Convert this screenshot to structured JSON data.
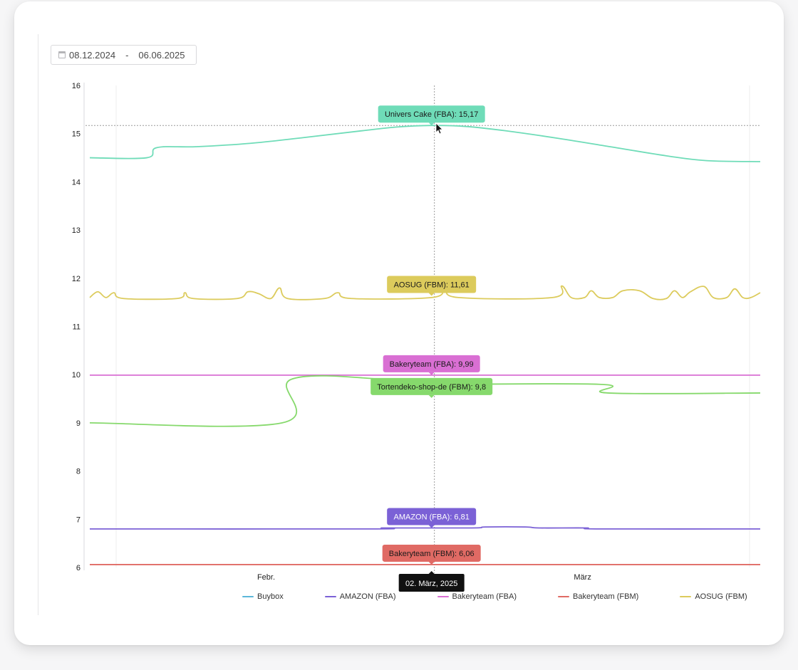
{
  "date_range": {
    "from": "08.12.2024",
    "separator": "-",
    "to": "06.06.2025"
  },
  "colors": {
    "buybox": "#5bb7d9",
    "amazon_fba": "#7b61d6",
    "bakeryteam_fba": "#d96fd3",
    "bakeryteam_fbm": "#e06a64",
    "aosug_fbm": "#dccb5c",
    "univers_cake_fba": "#6fdcb8",
    "tortendeko_fbm": "#86d96c"
  },
  "chart_data": {
    "type": "line",
    "ylim": [
      6,
      16
    ],
    "y_ticks": [
      "6",
      "7",
      "8",
      "9",
      "10",
      "11",
      "12",
      "13",
      "14",
      "15",
      "16"
    ],
    "x_ticks": [
      "Febr.",
      "März"
    ],
    "xlim": [
      0,
      100
    ],
    "hover": {
      "x": 51.4,
      "date_label": "02. März, 2025",
      "value": 15.17
    },
    "series": [
      {
        "name": "Univers Cake (FBA)",
        "color": "#6fdcb8",
        "tooltip": "Univers Cake (FBA): 15,17",
        "points": [
          [
            0,
            14.5
          ],
          [
            8.5,
            14.5
          ],
          [
            10,
            14.71
          ],
          [
            16,
            14.73
          ],
          [
            24,
            14.8
          ],
          [
            32,
            14.92
          ],
          [
            40,
            15.05
          ],
          [
            46,
            15.14
          ],
          [
            51,
            15.17
          ],
          [
            56,
            15.15
          ],
          [
            62,
            15.06
          ],
          [
            70,
            14.9
          ],
          [
            78,
            14.72
          ],
          [
            86,
            14.54
          ],
          [
            92,
            14.44
          ],
          [
            100,
            14.42
          ]
        ]
      },
      {
        "name": "AOSUG (FBM)",
        "color": "#dccb5c",
        "tooltip": "AOSUG (FBM): 11,61",
        "points": [
          [
            0,
            11.6
          ],
          [
            1.2,
            11.72
          ],
          [
            2.4,
            11.6
          ],
          [
            3.6,
            11.7
          ],
          [
            5,
            11.58
          ],
          [
            13,
            11.58
          ],
          [
            14.2,
            11.7
          ],
          [
            15.4,
            11.58
          ],
          [
            22,
            11.58
          ],
          [
            23.6,
            11.72
          ],
          [
            25.2,
            11.68
          ],
          [
            27,
            11.58
          ],
          [
            28.3,
            11.8
          ],
          [
            29.5,
            11.58
          ],
          [
            35,
            11.58
          ],
          [
            37,
            11.7
          ],
          [
            39,
            11.58
          ],
          [
            51,
            11.6
          ],
          [
            53,
            11.78
          ],
          [
            55,
            11.6
          ],
          [
            69,
            11.6
          ],
          [
            70.4,
            11.84
          ],
          [
            71.8,
            11.6
          ],
          [
            73.8,
            11.6
          ],
          [
            74.8,
            11.74
          ],
          [
            76,
            11.6
          ],
          [
            78,
            11.6
          ],
          [
            79.5,
            11.74
          ],
          [
            82,
            11.74
          ],
          [
            84,
            11.58
          ],
          [
            86,
            11.58
          ],
          [
            87.2,
            11.74
          ],
          [
            88.4,
            11.6
          ],
          [
            89.6,
            11.72
          ],
          [
            91.6,
            11.83
          ],
          [
            93,
            11.6
          ],
          [
            95,
            11.6
          ],
          [
            96.2,
            11.78
          ],
          [
            97.4,
            11.6
          ],
          [
            98.6,
            11.6
          ],
          [
            100,
            11.7
          ]
        ]
      },
      {
        "name": "Bakeryteam (FBA)",
        "color": "#d96fd3",
        "tooltip": "Bakeryteam (FBA): 9,99",
        "points": [
          [
            0,
            9.99
          ],
          [
            100,
            9.99
          ]
        ]
      },
      {
        "name": "Tortendeko-shop-de (FBM)",
        "color": "#86d96c",
        "tooltip": "Tortendeko-shop-de (FBM): 9,8",
        "points": [
          [
            0,
            9.0
          ],
          [
            28.7,
            9.0
          ],
          [
            30,
            9.9
          ],
          [
            44,
            9.9
          ],
          [
            45.3,
            9.8
          ],
          [
            76,
            9.8
          ],
          [
            77.3,
            9.62
          ],
          [
            100,
            9.62
          ]
        ]
      },
      {
        "name": "AMAZON (FBA)",
        "color": "#7b61d6",
        "tooltip": "AMAZON (FBA): 6,81",
        "points": [
          [
            0,
            6.8
          ],
          [
            42,
            6.8
          ],
          [
            44,
            6.82
          ],
          [
            57,
            6.82
          ],
          [
            59,
            6.84
          ],
          [
            65,
            6.84
          ],
          [
            67,
            6.82
          ],
          [
            74,
            6.82
          ],
          [
            76,
            6.8
          ],
          [
            100,
            6.8
          ]
        ]
      },
      {
        "name": "Bakeryteam (FBM)",
        "color": "#e06a64",
        "tooltip": "Bakeryteam (FBM): 6,06",
        "points": [
          [
            0,
            6.06
          ],
          [
            100,
            6.06
          ]
        ]
      }
    ],
    "legend": [
      {
        "label": "Buybox",
        "color": "#5bb7d9"
      },
      {
        "label": "AMAZON (FBA)",
        "color": "#7b61d6"
      },
      {
        "label": "Bakeryteam (FBA)",
        "color": "#d96fd3"
      },
      {
        "label": "Bakeryteam (FBM)",
        "color": "#e06a64"
      },
      {
        "label": "AOSUG (FBM)",
        "color": "#dccb5c"
      }
    ]
  }
}
